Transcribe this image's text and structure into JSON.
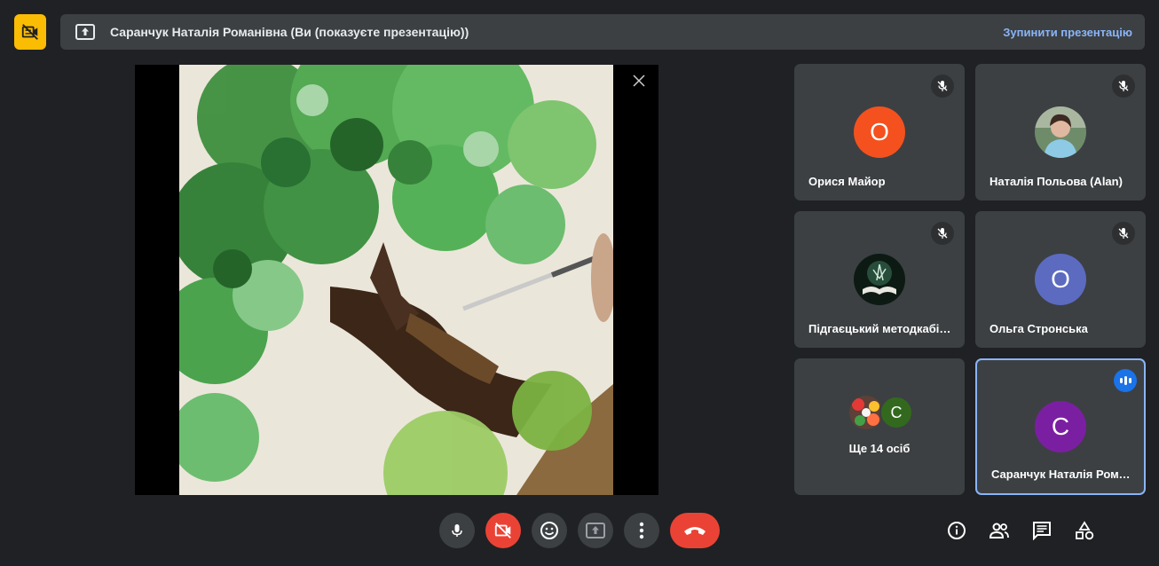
{
  "header": {
    "presenter_title": "Саранчук Наталія Романівна (Ви (показуєте презентацію))",
    "stop_presentation_label": "Зупинити презентацію"
  },
  "participants": [
    {
      "name": "Орися Майор",
      "initial": "О",
      "avatar_color": "#f4511e",
      "muted": true
    },
    {
      "name": "Наталія Польова (Alan)",
      "initial": "",
      "avatar_type": "photo",
      "muted": true
    },
    {
      "name": "Підгаєцький методкабінет",
      "initial": "",
      "avatar_type": "book-image",
      "muted": true
    },
    {
      "name": "Ольга Стронська",
      "initial": "О",
      "avatar_color": "#5c6bc0",
      "muted": true
    },
    {
      "name": "Саранчук Наталія Романівна",
      "initial": "С",
      "avatar_color": "#7b1fa2",
      "speaking": true
    }
  ],
  "more_participants": {
    "label": "Ще 14 осіб",
    "second_initial": "С",
    "second_color": "#33691e"
  },
  "controls": {
    "mic": "microphone-icon",
    "camera": "camera-off-icon",
    "reactions": "emoji-icon",
    "present": "present-screen-icon",
    "more": "more-vert-icon",
    "hangup": "hangup-icon"
  },
  "side_controls": [
    "info-icon",
    "people-icon",
    "chat-icon",
    "activities-icon"
  ],
  "colors": {
    "background": "#202124",
    "tile": "#3c4043",
    "accent_blue": "#8ab4f8",
    "warning_yellow": "#fbbc04",
    "danger_red": "#ea4335"
  }
}
